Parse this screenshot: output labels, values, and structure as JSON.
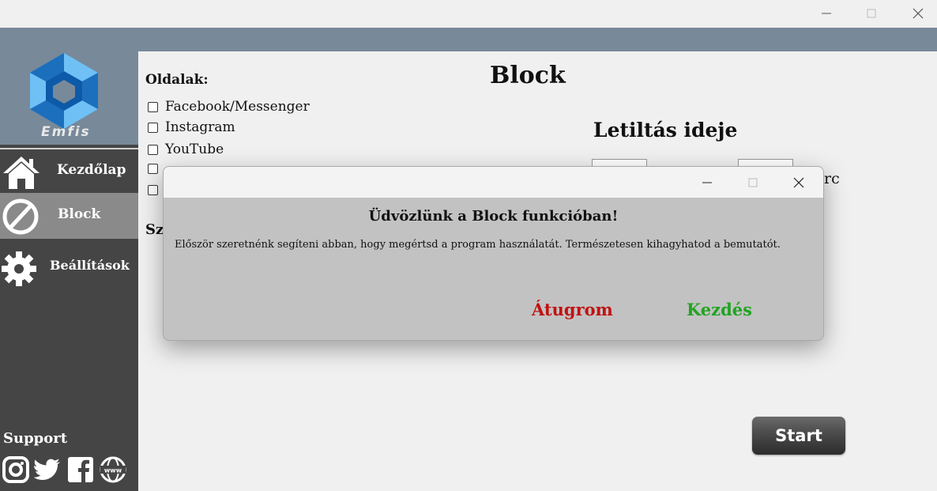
{
  "window": {
    "controls": {
      "minimize": "minimize-icon",
      "maximize": "maximize-icon",
      "close": "close-icon"
    }
  },
  "app": {
    "logo_text": "Emfis",
    "logo_colors": {
      "outer": "#2e8bd6",
      "inner": "#0d5aa8"
    }
  },
  "sidebar": {
    "items": [
      {
        "label": "Kezdőlap",
        "icon": "home-icon"
      },
      {
        "label": "Block",
        "icon": "block-icon"
      },
      {
        "label": "Beállítások",
        "icon": "gear-icon"
      }
    ],
    "support": {
      "label": "Support",
      "icons": [
        "instagram-icon",
        "twitter-icon",
        "facebook-icon",
        "www-icon"
      ]
    }
  },
  "main": {
    "title": "Block",
    "sites_heading": "Oldalak:",
    "sites": [
      {
        "label": "Facebook/Messenger",
        "checked": false
      },
      {
        "label": "Instagram",
        "checked": false
      },
      {
        "label": "YouTube",
        "checked": false
      }
    ],
    "sz_label": "Sz",
    "duration_heading": "Letiltás ideje",
    "minutes_suffix": "rc",
    "start_label": "Start"
  },
  "dialog": {
    "heading": "Üdvözlünk a Block funkcióban!",
    "body": "Először szeretnénk segíteni abban, hogy megértsd a program használatát. Természetesen kihagyhatod a bemutatót.",
    "skip_label": "Átugrom",
    "start_label": "Kezdés",
    "colors": {
      "skip": "#c01212",
      "start": "#22a422"
    }
  }
}
